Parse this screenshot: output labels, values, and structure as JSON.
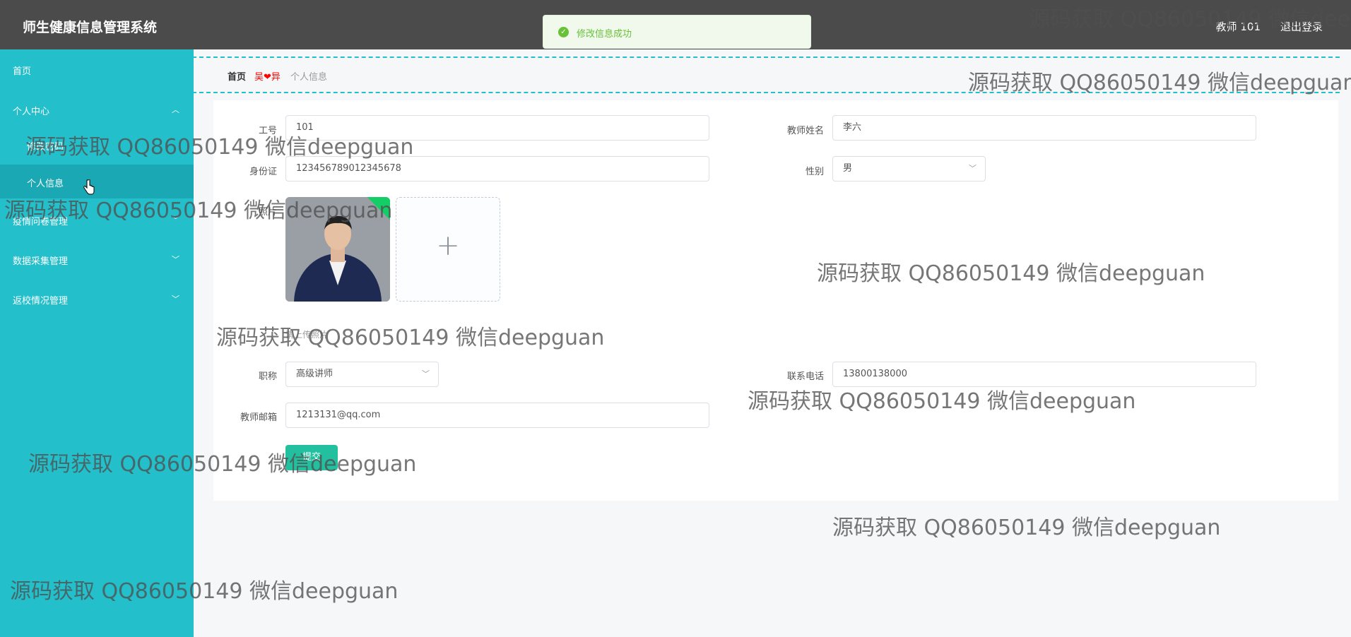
{
  "header": {
    "title": "师生健康信息管理系统",
    "user_label": "教师 101",
    "logout_label": "退出登录"
  },
  "toast": {
    "message": "修改信息成功",
    "icon": "success-check-icon",
    "color": "#67c23a"
  },
  "sidebar": {
    "items": [
      {
        "label": "首页"
      },
      {
        "label": "个人中心",
        "expanded": true,
        "icon": "chevron-up-icon"
      },
      {
        "label": "修改密码"
      },
      {
        "label": "个人信息",
        "active": true
      },
      {
        "label": "疫情问卷管理",
        "icon": "chevron-down-icon"
      },
      {
        "label": "数据采集管理",
        "icon": "chevron-down-icon"
      },
      {
        "label": "返校情况管理",
        "icon": "chevron-down-icon"
      }
    ]
  },
  "breadcrumb": {
    "home": "首页",
    "separator": "吴❤异",
    "current": "个人信息"
  },
  "form": {
    "gonghao": {
      "label": "工号",
      "value": "101"
    },
    "name": {
      "label": "教师姓名",
      "value": "李六"
    },
    "idcard": {
      "label": "身份证",
      "value": "123456789012345678"
    },
    "gender": {
      "label": "性别",
      "value": "男"
    },
    "photo": {
      "label": "照片",
      "tip": "请上传照片"
    },
    "title": {
      "label": "职称",
      "value": "高级讲师"
    },
    "phone": {
      "label": "联系电话",
      "value": "13800138000"
    },
    "email": {
      "label": "教师邮箱",
      "value": "1213131@qq.com"
    },
    "submit_label": "提交"
  },
  "watermark": "源码获取 QQ86050149 微信deepguan",
  "colors": {
    "sidebar": "#23c0cc",
    "header": "#4b4b4b",
    "accent": "#23c0a0"
  }
}
